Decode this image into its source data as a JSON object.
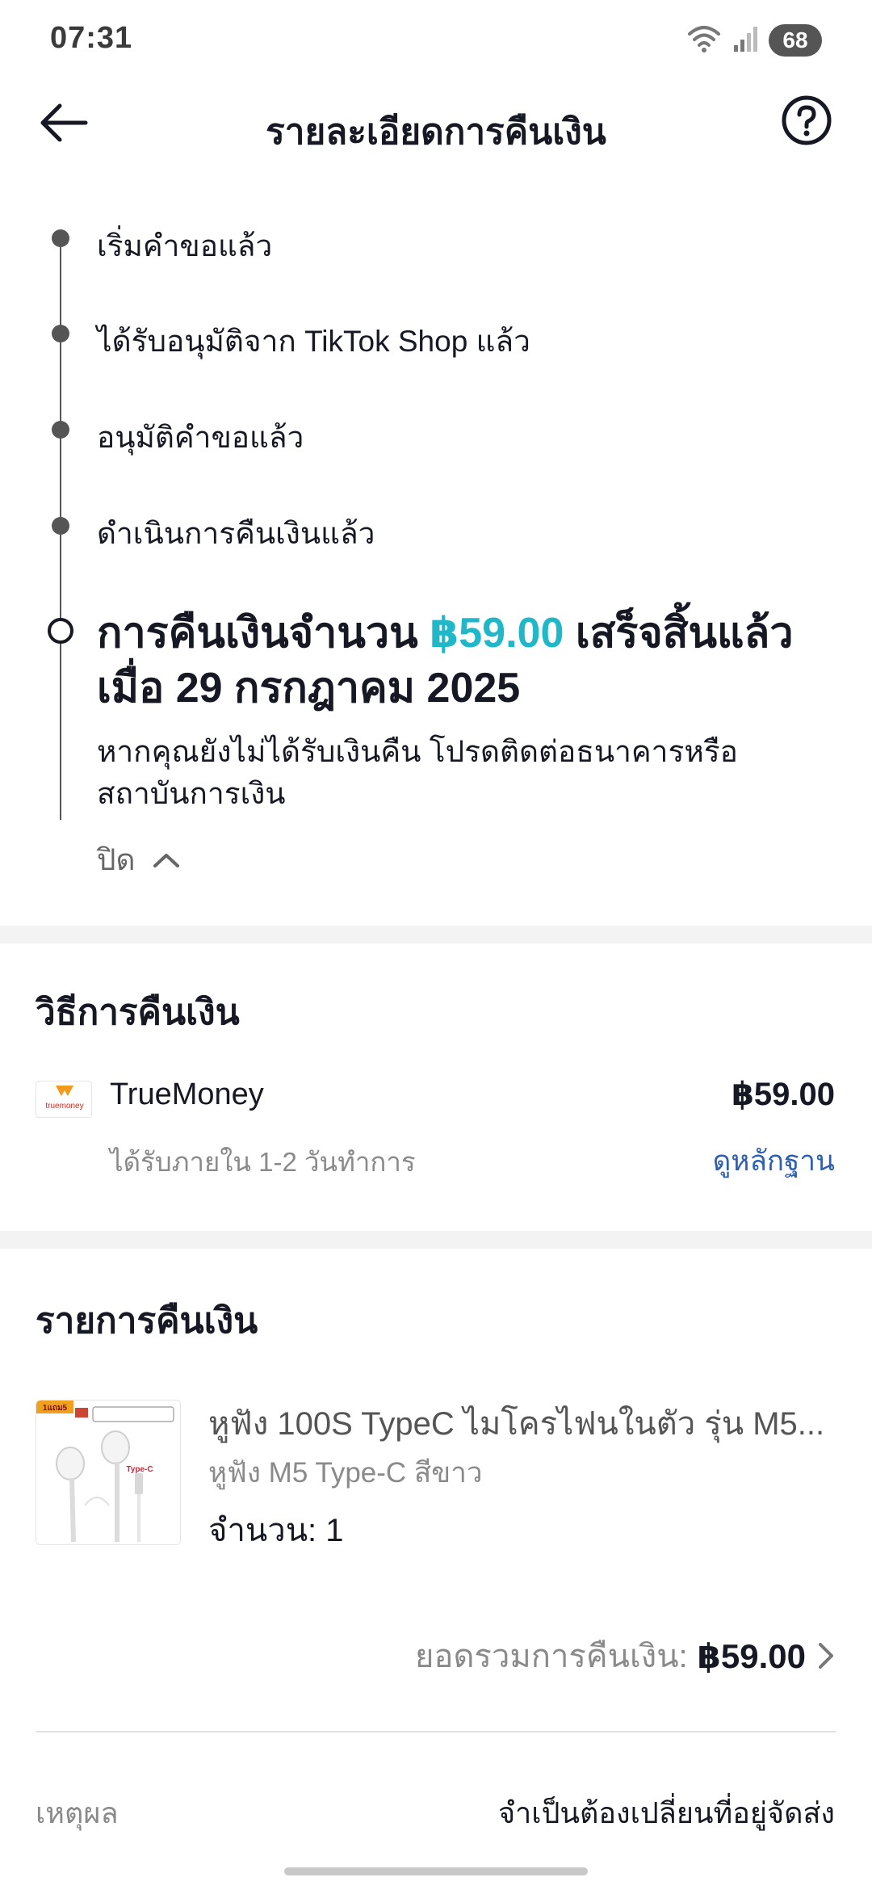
{
  "status_bar": {
    "time": "07:31",
    "battery": "68"
  },
  "header": {
    "title": "รายละเอียดการคืนเงิน"
  },
  "timeline": {
    "steps": [
      "เริ่มคำขอแล้ว",
      "ได้รับอนุมัติจาก TikTok Shop แล้ว",
      "อนุมัติคำขอแล้ว",
      "ดำเนินการคืนเงินแล้ว"
    ],
    "final": {
      "title_before": "การคืนเงินจำนวน ",
      "amount": "฿59.00",
      "title_after": " เสร็จสิ้นแล้วเมื่อ 29 กรกฎาคม 2025",
      "note": "หากคุณยังไม่ได้รับเงินคืน โปรดติดต่อธนาคารหรือสถาบันการเงิน",
      "toggle_label": "ปิด"
    }
  },
  "refund_method": {
    "section_title": "วิธีการคืนเงิน",
    "name": "TrueMoney",
    "logo_text": "truemoney",
    "amount": "฿59.00",
    "eta": "ได้รับภายใน 1-2 วันทำการ",
    "proof_link": "ดูหลักฐาน"
  },
  "refund_items": {
    "section_title": "รายการคืนเงิน",
    "product": {
      "name": "หูฟัง 100S TypeC ไมโครไฟนในตัว รุ่น M5...",
      "variant": "หูฟัง M5 Type-C สีขาว",
      "quantity_label": "จำนวน: 1",
      "thumb_badge": "1แถม5",
      "thumb_label": "Type-C"
    },
    "total_label": "ยอดรวมการคืนเงิน:",
    "total_value": "฿59.00"
  },
  "reason": {
    "label": "เหตุผล",
    "value": "จำเป็นต้องเปลี่ยนที่อยู่จัดส่ง"
  },
  "colors": {
    "accent": "#20b8c8",
    "link": "#2f5fb0",
    "divider": "#f3f3f3"
  }
}
